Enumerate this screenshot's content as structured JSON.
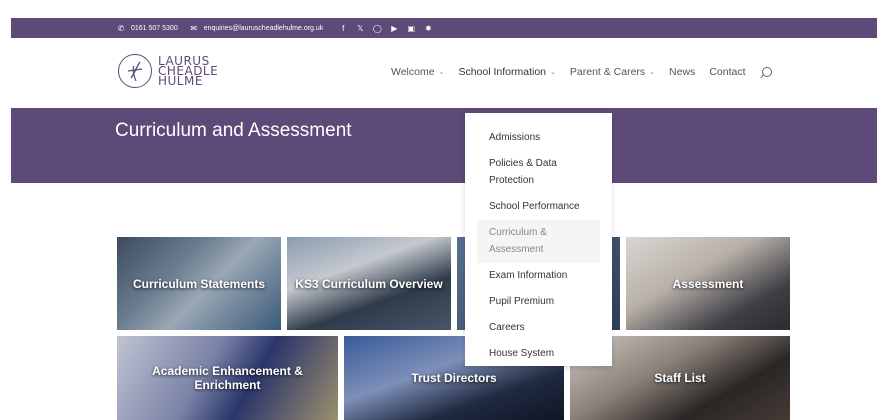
{
  "topbar": {
    "phone": "0161 507 5300",
    "email": "enquiries@lauruscheadlehulme.org.uk",
    "social_icons": [
      "facebook-icon",
      "x-icon",
      "instagram-icon",
      "youtube-icon",
      "vimeo-icon",
      "settings-icon"
    ]
  },
  "logo": {
    "line1": "LAURUS",
    "line2": "CHEADLE",
    "line3": "HULME"
  },
  "nav": {
    "items": [
      {
        "label": "Welcome",
        "has_dropdown": true
      },
      {
        "label": "School Information",
        "has_dropdown": true
      },
      {
        "label": "Parent & Carers",
        "has_dropdown": true
      },
      {
        "label": "News",
        "has_dropdown": false
      },
      {
        "label": "Contact",
        "has_dropdown": false
      }
    ],
    "dropdown_chevron": "⌄"
  },
  "banner": {
    "title": "Curriculum and Assessment"
  },
  "tiles": [
    "Curriculum Statements",
    "KS3 Curriculum Overview",
    "",
    "Assessment",
    "Academic Enhancement & Enrichment",
    "Trust Directors",
    "Staff List"
  ],
  "dropdown": {
    "items": [
      "Admissions",
      "Policies & Data Protection",
      "School Performance",
      "Curriculum & Assessment",
      "Exam Information",
      "Pupil Premium",
      "Careers",
      "House System"
    ],
    "current_index": 3
  },
  "colors": {
    "brand_purple": "#5d4a78"
  }
}
